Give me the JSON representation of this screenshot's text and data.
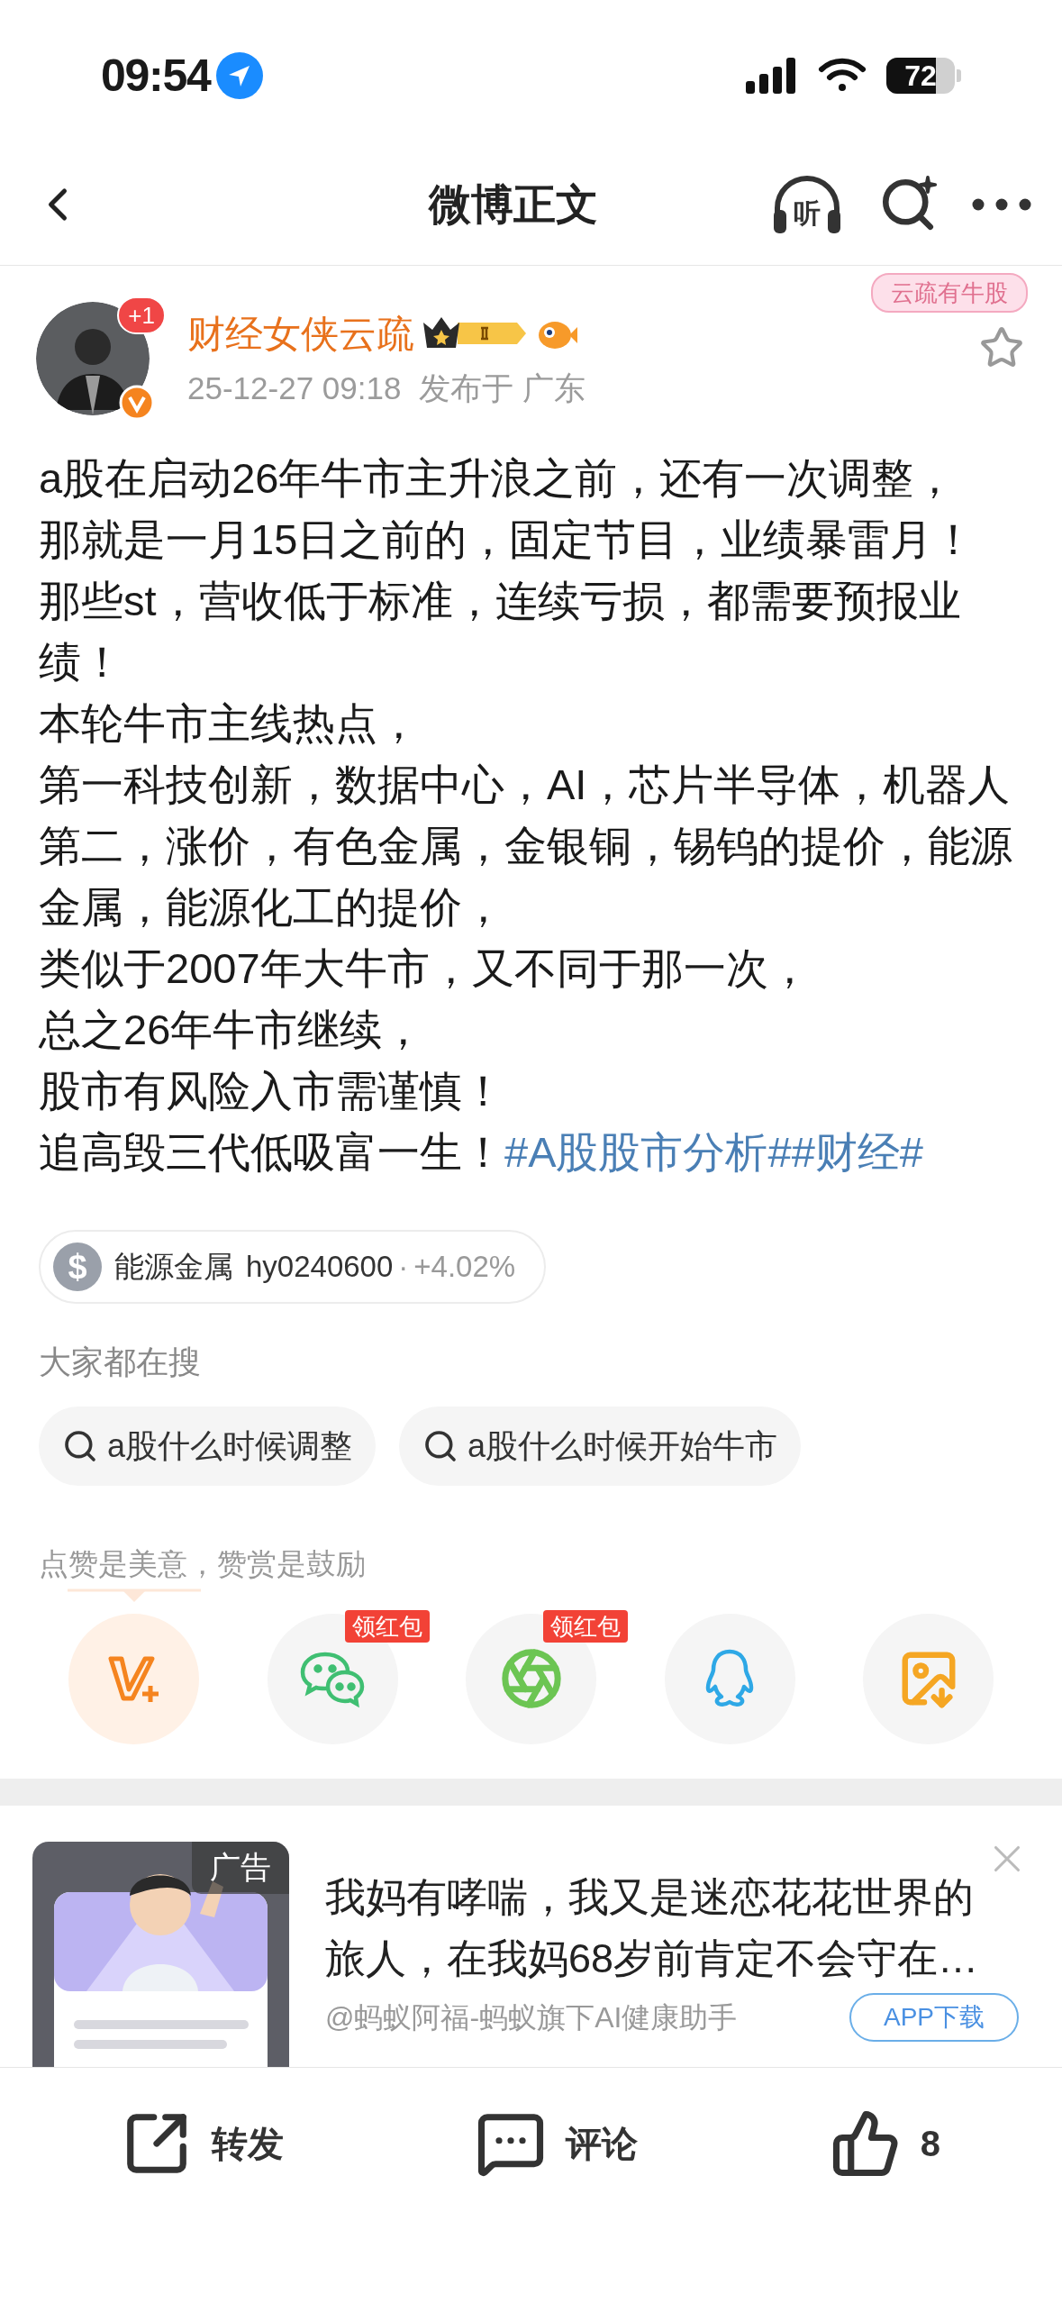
{
  "status_bar": {
    "time": "09:54",
    "battery": "72"
  },
  "nav": {
    "title": "微博正文",
    "listen_glyph": "听"
  },
  "author": {
    "name": "财经女侠云疏",
    "avatar_badge": "+1",
    "meta_time": "25-12-27 09:18",
    "meta_location": "发布于 广东",
    "sticker": "云疏有牛股",
    "favorited": false
  },
  "post": {
    "paragraphs": [
      "a股在启动26年牛市主升浪之前，还有一次调整，",
      "那就是一月15日之前的，固定节目，业绩暴雷月！",
      "那些st，营收低于标准，连续亏损，都需要预报业绩！",
      "本轮牛市主线热点，",
      "第一科技创新，数据中心，AI，芯片半导体，机器人",
      "第二，涨价，有色金属，金银铜，锡钨的提价，能源金属，能源化工的提价，",
      "类似于2007年大牛市，又不同于那一次，",
      "总之26年牛市继续，",
      "股市有风险入市需谨慎！",
      "追高毁三代低吸富一生！"
    ],
    "topics": [
      "#A股股市分析#",
      "#财经#"
    ]
  },
  "stock_chip": {
    "symbol": "$",
    "name": "能源金属",
    "code": "hy0240600",
    "separator": "·",
    "change": "+4.02%"
  },
  "trending": {
    "title": "大家都在搜",
    "queries": [
      "a股什么时候调整",
      "a股什么时候开始牛市"
    ]
  },
  "reward": {
    "caption": "点赞是美意，赞赏是鼓励",
    "share_targets": [
      {
        "kind": "vplus",
        "highlighted": true
      },
      {
        "kind": "wechat",
        "badge": "领红包",
        "highlighted": false
      },
      {
        "kind": "moments",
        "badge": "领红包",
        "highlighted": false
      },
      {
        "kind": "qq",
        "highlighted": false
      },
      {
        "kind": "save",
        "highlighted": false
      }
    ]
  },
  "ad": {
    "label": "广告",
    "text": "我妈有哮喘，我又是迷恋花花世界的旅人，在我妈68岁前肯定不会守在…",
    "source": "@蚂蚁阿福-蚂蚁旗下AI健康助手",
    "button": "APP下载"
  },
  "bottom_bar": {
    "repost": "转发",
    "comment": "评论",
    "likes": "8"
  }
}
